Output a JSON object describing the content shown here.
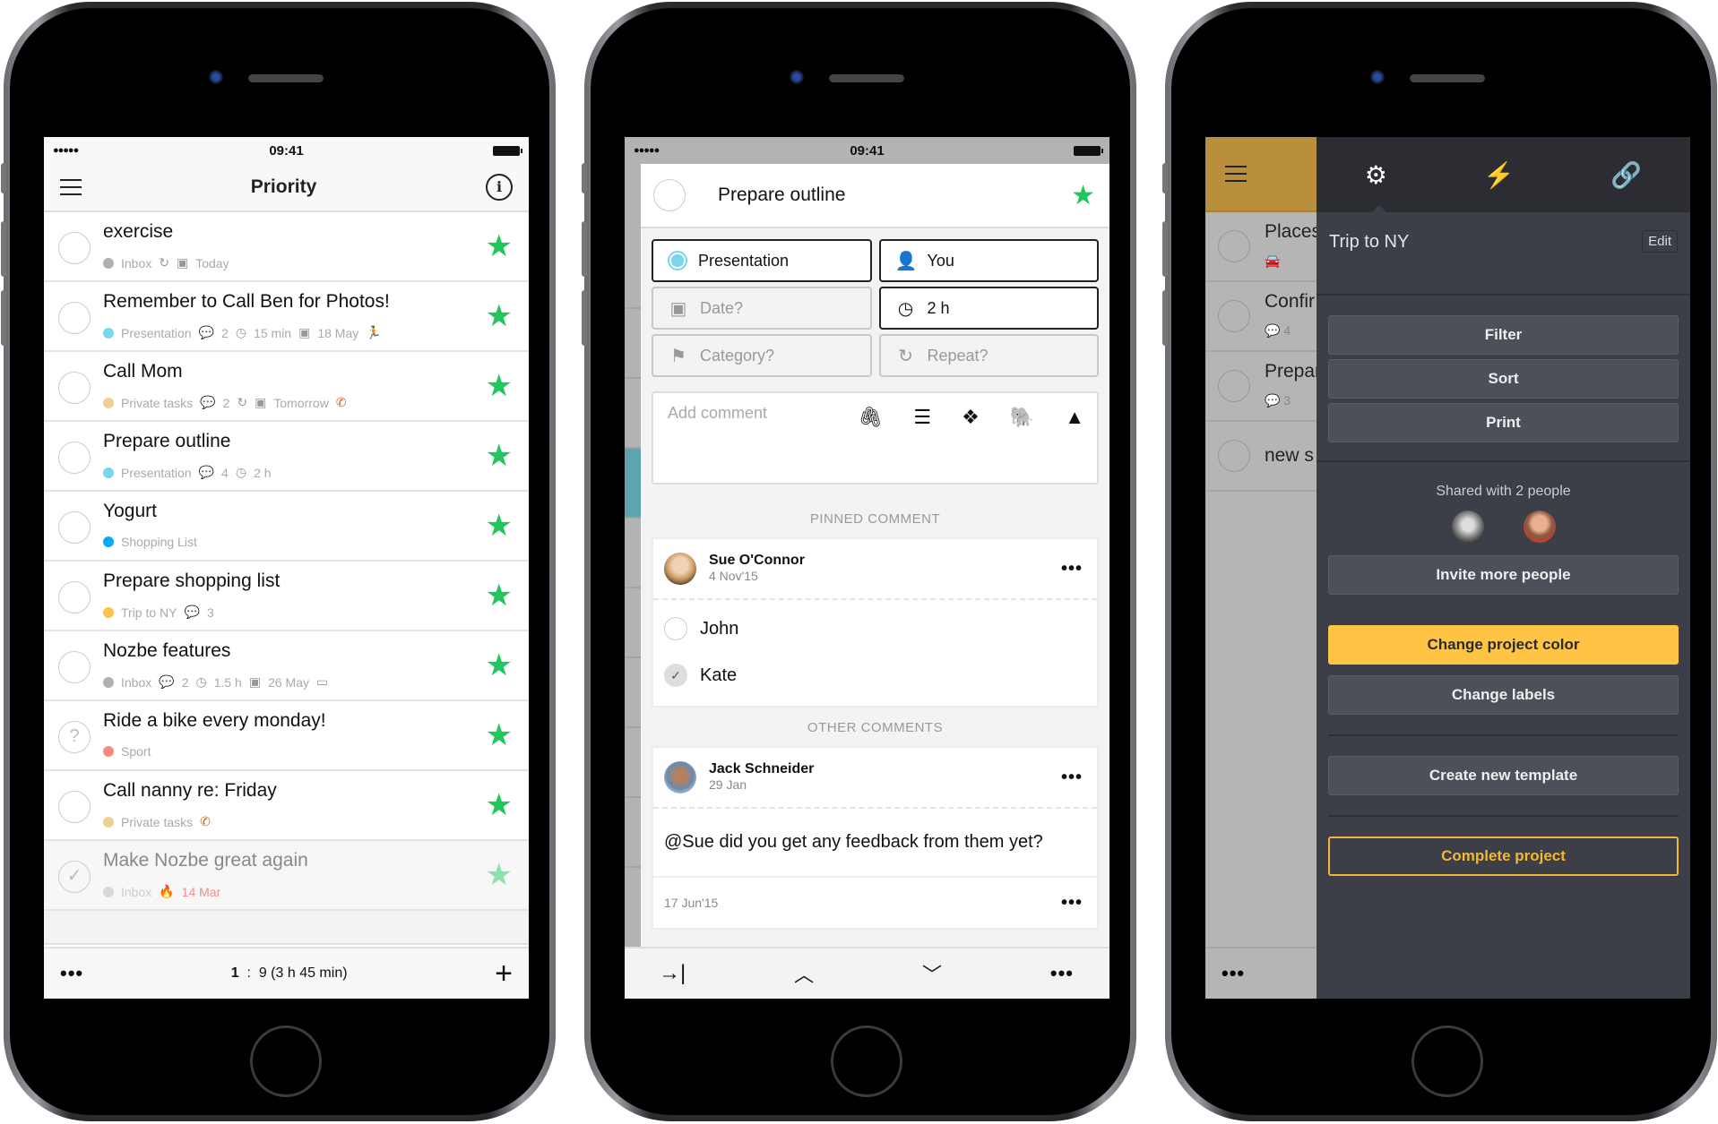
{
  "status_bar": {
    "time": "09:41",
    "signal": "●●●●●",
    "wifi": "wifi"
  },
  "phone1": {
    "nav": {
      "title": "Priority",
      "menu_icon": "hamburger-icon",
      "info_icon": "info-icon"
    },
    "tasks": [
      {
        "name": "exercise",
        "project": "Inbox",
        "project_color": "#b0b0b0",
        "meta": [
          {
            "icon": "↻",
            "icon_name": "repeat-icon",
            "text": ""
          },
          {
            "icon": "▣",
            "icon_name": "calendar-icon",
            "text": "Today"
          }
        ],
        "starred": true,
        "state": "open"
      },
      {
        "name": "Remember to Call Ben for Photos!",
        "project": "Presentation",
        "project_color": "#78d8ee",
        "meta": [
          {
            "icon": "💬",
            "icon_name": "comment-icon",
            "text": "2"
          },
          {
            "icon": "◷",
            "icon_name": "clock-icon",
            "text": "15 min"
          },
          {
            "icon": "▣",
            "icon_name": "calendar-icon",
            "text": "18 May"
          },
          {
            "icon": "🏃",
            "icon_name": "running-icon",
            "text": "",
            "color": "#f5826b"
          }
        ],
        "starred": true,
        "state": "open"
      },
      {
        "name": "Call Mom",
        "project": "Private tasks",
        "project_color": "#edcf94",
        "meta": [
          {
            "icon": "💬",
            "icon_name": "comment-icon",
            "text": "2"
          },
          {
            "icon": "↻",
            "icon_name": "repeat-icon",
            "text": ""
          },
          {
            "icon": "▣",
            "icon_name": "calendar-icon",
            "text": "Tomorrow"
          },
          {
            "icon": "✆",
            "icon_name": "phone-icon",
            "text": "",
            "color": "#c9622f"
          }
        ],
        "starred": true,
        "state": "open"
      },
      {
        "name": "Prepare outline",
        "project": "Presentation",
        "project_color": "#78d8ee",
        "meta": [
          {
            "icon": "💬",
            "icon_name": "comment-icon",
            "text": "4"
          },
          {
            "icon": "◷",
            "icon_name": "clock-icon",
            "text": "2 h"
          }
        ],
        "starred": true,
        "state": "open"
      },
      {
        "name": "Yogurt",
        "project": "Shopping List",
        "project_color": "#0aa9f5",
        "meta": [],
        "starred": true,
        "state": "open"
      },
      {
        "name": "Prepare shopping list",
        "project": "Trip to NY",
        "project_color": "#fec246",
        "meta": [
          {
            "icon": "💬",
            "icon_name": "comment-icon",
            "text": "3"
          }
        ],
        "starred": true,
        "state": "open"
      },
      {
        "name": "Nozbe features",
        "project": "Inbox",
        "project_color": "#b0b0b0",
        "meta": [
          {
            "icon": "💬",
            "icon_name": "comment-icon",
            "text": "2"
          },
          {
            "icon": "◷",
            "icon_name": "clock-icon",
            "text": "1.5 h"
          },
          {
            "icon": "▣",
            "icon_name": "calendar-icon",
            "text": "26 May"
          },
          {
            "icon": "▭",
            "icon_name": "computer-icon",
            "text": ""
          }
        ],
        "starred": true,
        "state": "open"
      },
      {
        "name": "Ride a bike every monday!",
        "project": "Sport",
        "project_color": "#f98b7a",
        "meta": [],
        "starred": true,
        "state": "question"
      },
      {
        "name": "Call nanny re: Friday",
        "project": "Private tasks",
        "project_color": "#edcf94",
        "meta": [
          {
            "icon": "✆",
            "icon_name": "phone-icon",
            "text": "",
            "color": "#c9622f"
          }
        ],
        "starred": true,
        "state": "open"
      },
      {
        "name": "Make Nozbe great again",
        "project": "Inbox",
        "project_color": "#d8d8d8",
        "meta": [
          {
            "icon": "🔥",
            "icon_name": "fire-icon",
            "text": "14 Mar",
            "color": "#f28b8b"
          }
        ],
        "starred": true,
        "state": "done"
      }
    ],
    "bottom": {
      "summary_count": "1",
      "summary_sep": ":",
      "summary_total": "9 (3 h 45 min)",
      "more": "•••",
      "add": "+"
    }
  },
  "phone2": {
    "task_title": "Prepare outline",
    "fields": {
      "project": "Presentation",
      "responsible": "You",
      "date": "Date?",
      "time_needed": "2 h",
      "category": "Category?",
      "repeat": "Repeat?"
    },
    "comment_placeholder": "Add comment",
    "pinned_label": "PINNED COMMENT",
    "pinned": {
      "author": "Sue O'Connor",
      "date": "4 Nov'15",
      "checklist": [
        {
          "label": "John",
          "checked": false
        },
        {
          "label": "Kate",
          "checked": true
        }
      ]
    },
    "other_label": "OTHER COMMENTS",
    "comments": [
      {
        "author": "Jack Schneider",
        "date": "29 Jan",
        "text": "@Sue did you get any feedback from them yet?",
        "footer_date": "17 Jun'15"
      }
    ],
    "toolbar": {
      "move": "→|",
      "up": "⌃",
      "down": "⌄",
      "more": "•••"
    }
  },
  "phone3": {
    "background_rows": [
      {
        "name": "Places",
        "meta": "🚘"
      },
      {
        "name": "Confir",
        "meta": "💬 4"
      },
      {
        "name": "Prepar",
        "meta": "💬 3"
      },
      {
        "name": "new s",
        "meta": ""
      }
    ],
    "accent_color": "#b98f3c",
    "tabs": [
      {
        "name": "settings",
        "icon": "⚙",
        "active": true
      },
      {
        "name": "actions",
        "icon": "⚡",
        "active": false
      },
      {
        "name": "attachments",
        "icon": "🔗",
        "active": false
      }
    ],
    "project_name": "Trip to NY",
    "edit_label": "Edit",
    "buttons": {
      "filter": "Filter",
      "sort": "Sort",
      "print": "Print"
    },
    "shared_label": "Shared with 2 people",
    "invite": "Invite more people",
    "change_color": "Change project color",
    "change_labels": "Change labels",
    "create_template": "Create new template",
    "complete": "Complete project",
    "more": "•••"
  }
}
